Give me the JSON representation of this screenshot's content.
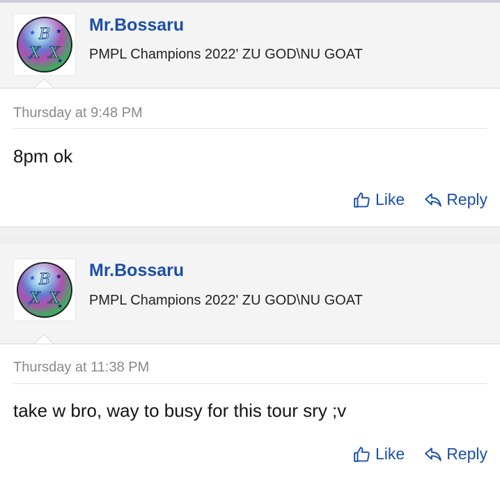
{
  "posts": [
    {
      "username": "Mr.Bossaru",
      "user_title": "PMPL Champions 2022' ZU GOD\\NU GOAT",
      "timestamp": "Thursday at 9:48 PM",
      "message": "8pm ok",
      "like_label": "Like",
      "reply_label": "Reply"
    },
    {
      "username": "Mr.Bossaru",
      "user_title": "PMPL Champions 2022' ZU GOD\\NU GOAT",
      "timestamp": "Thursday at 11:38 PM",
      "message": "take w bro, way to busy for this tour sry ;v",
      "like_label": "Like",
      "reply_label": "Reply"
    }
  ],
  "avatar": {
    "letters": [
      "B",
      "X",
      "X"
    ]
  },
  "colors": {
    "link": "#1b4fa8",
    "timestamp": "#8a8a8a",
    "header_bg": "#f4f4f4",
    "body_bg": "#ffffff"
  },
  "icons": {
    "like": "thumbs-up-icon",
    "reply": "reply-arrow-icon"
  }
}
